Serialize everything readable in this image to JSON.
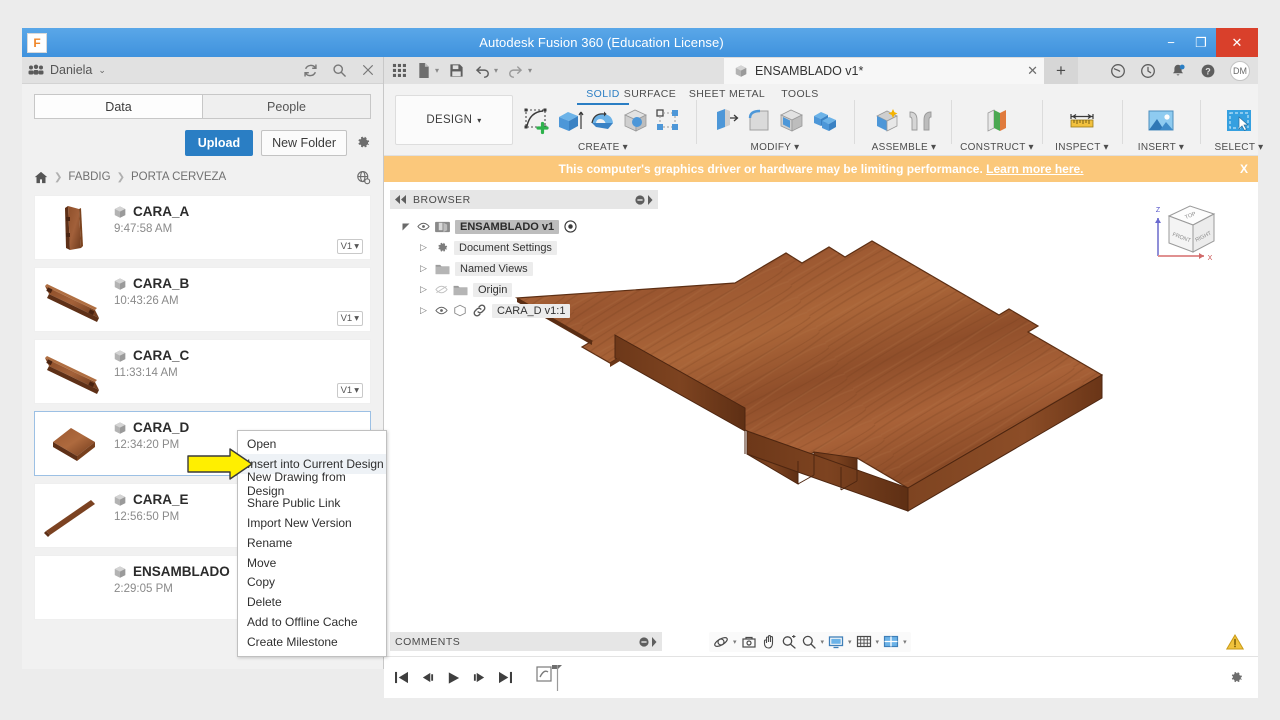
{
  "window": {
    "title": "Autodesk Fusion 360 (Education License)",
    "app_icon": "F",
    "minimize": "−",
    "restore": "❐",
    "close": "✕"
  },
  "data_panel": {
    "user_name": "Daniela",
    "user_caret": "⌄",
    "people_icon": "people-icon",
    "refresh_icon": "refresh-icon",
    "search_icon": "search-icon",
    "close_icon": "close-icon",
    "tabs": [
      {
        "label": "Data",
        "active": true
      },
      {
        "label": "People",
        "active": false
      }
    ],
    "upload_label": "Upload",
    "new_folder_label": "New Folder",
    "settings_icon": "gear-icon",
    "breadcrumb": {
      "home_icon": "home-icon",
      "items": [
        "FABDIG",
        "PORTA CERVEZA"
      ],
      "separator": "❯",
      "globe_icon": "globe-icon"
    },
    "files": [
      {
        "name": "CARA_A",
        "time": "9:47:58 AM",
        "version": "V1",
        "thumb": "part-a",
        "selected": false
      },
      {
        "name": "CARA_B",
        "time": "10:43:26 AM",
        "version": "V1",
        "thumb": "part-b",
        "selected": false
      },
      {
        "name": "CARA_C",
        "time": "11:33:14 AM",
        "version": "V1",
        "thumb": "part-c",
        "selected": false
      },
      {
        "name": "CARA_D",
        "time": "12:34:20 PM",
        "version": "",
        "thumb": "part-d",
        "selected": true
      },
      {
        "name": "CARA_E",
        "time": "12:56:50 PM",
        "version": "",
        "thumb": "part-e",
        "selected": false
      },
      {
        "name": "ENSAMBLADO",
        "time": "2:29:05 PM",
        "version": "",
        "thumb": "none",
        "selected": false
      }
    ],
    "version_caret": "▾"
  },
  "context_menu": {
    "items": [
      {
        "label": "Open",
        "hover": false
      },
      {
        "label": "Insert into Current Design",
        "hover": true
      },
      {
        "label": "New Drawing from Design",
        "hover": false
      },
      {
        "label": "Share Public Link",
        "hover": false
      },
      {
        "label": "Import New Version",
        "hover": false
      },
      {
        "label": "Rename",
        "hover": false
      },
      {
        "label": "Move",
        "hover": false
      },
      {
        "label": "Copy",
        "hover": false
      },
      {
        "label": "Delete",
        "hover": false
      },
      {
        "label": "Add to Offline Cache",
        "hover": false
      },
      {
        "label": "Create Milestone",
        "hover": false
      }
    ],
    "cursor_arrow_color": "#ffef00"
  },
  "quick_access": {
    "grid_icon": "grid-apps-icon",
    "file_icon": "new-file-icon",
    "save_icon": "save-icon",
    "undo_icon": "undo-icon",
    "redo_icon": "redo-icon",
    "caret": "▾",
    "doc_tab": {
      "label": "ENSAMBLADO v1*",
      "close": "✕",
      "cube_icon": "cube-icon"
    },
    "add_tab": "+",
    "right_icons": [
      "help-community-icon",
      "recent-icon",
      "notification-bell-icon",
      "help-icon"
    ],
    "avatar_initials": "DM"
  },
  "ribbon": {
    "workspace_label": "DESIGN",
    "workspace_caret": "▾",
    "tabs": [
      {
        "label": "SOLID",
        "active": true
      },
      {
        "label": "SURFACE",
        "active": false
      },
      {
        "label": "SHEET METAL",
        "active": false
      },
      {
        "label": "TOOLS",
        "active": false
      }
    ],
    "groups": [
      {
        "label": "CREATE ▾",
        "icons": [
          "create-sketch-icon",
          "extrude-icon",
          "revolve-icon",
          "sphere-icon",
          "pattern-icon"
        ]
      },
      {
        "label": "MODIFY ▾",
        "icons": [
          "press-pull-icon",
          "fillet-icon",
          "shell-icon",
          "combine-icon"
        ]
      },
      {
        "label": "ASSEMBLE ▾",
        "icons": [
          "new-component-icon",
          "joint-icon"
        ]
      },
      {
        "label": "CONSTRUCT ▾",
        "icons": [
          "construct-plane-icon"
        ]
      },
      {
        "label": "INSPECT ▾",
        "icons": [
          "measure-icon"
        ]
      },
      {
        "label": "INSERT ▾",
        "icons": [
          "insert-image-icon"
        ]
      },
      {
        "label": "SELECT ▾",
        "icons": [
          "select-window-icon"
        ]
      }
    ]
  },
  "warning_banner": {
    "message": "This computer's graphics driver or hardware may be limiting performance.",
    "link_text": "Learn more here.",
    "close": "X",
    "color": "#fbc87b"
  },
  "browser": {
    "title": "BROWSER",
    "collapse_icon": "collapse-left-icon",
    "settings_dot_icon": "circle-minus-icon",
    "tree": [
      {
        "label": "ENSAMBLADO v1",
        "indent": 0,
        "selected": true,
        "has_eye": true,
        "eye_on": true,
        "tri": "◢",
        "icon": "component-icon",
        "trailing": "target-icon"
      },
      {
        "label": "Document Settings",
        "indent": 1,
        "selected": false,
        "has_eye": false,
        "tri": "▷",
        "icon": "gear-icon"
      },
      {
        "label": "Named Views",
        "indent": 1,
        "selected": false,
        "has_eye": false,
        "tri": "▷",
        "icon": "folder-icon"
      },
      {
        "label": "Origin",
        "indent": 1,
        "selected": false,
        "has_eye": true,
        "eye_on": false,
        "tri": "▷",
        "icon": "folder-icon"
      },
      {
        "label": "CARA_D v1:1",
        "indent": 1,
        "selected": false,
        "has_eye": true,
        "eye_on": true,
        "tri": "▷",
        "icon": "body-icon",
        "trailing": "link-icon"
      }
    ]
  },
  "view_cube": {
    "faces": {
      "top": "TOP",
      "front": "FRONT",
      "right": "RIGHT"
    },
    "axes": {
      "z": "Z",
      "x": "X"
    }
  },
  "model": {
    "material": "wood",
    "base_color": "#9c5a32",
    "top_color": "#a9643a",
    "edge_color": "#6b3a1d",
    "description": "Rectangular wooden plate with notched tab cutouts"
  },
  "comments": {
    "title": "COMMENTS",
    "collapse_icon": "circle-minus-icon",
    "expand_icon": "expand-right-icon"
  },
  "nav_bar": {
    "icons": [
      "orbit-icon",
      "look-at-icon",
      "pan-icon",
      "zoom-window-icon",
      "zoom-icon",
      "display-settings-icon",
      "grid-snap-icon",
      "viewport-layout-icon"
    ],
    "caret": "▾",
    "warning_icon": "warning-triangle-icon"
  },
  "timeline": {
    "controls": [
      "go-to-beginning-icon",
      "step-back-icon",
      "play-icon",
      "step-forward-icon",
      "go-to-end-icon"
    ],
    "marker_icon": "timeline-marker-icon",
    "settings_icon": "gear-icon"
  }
}
